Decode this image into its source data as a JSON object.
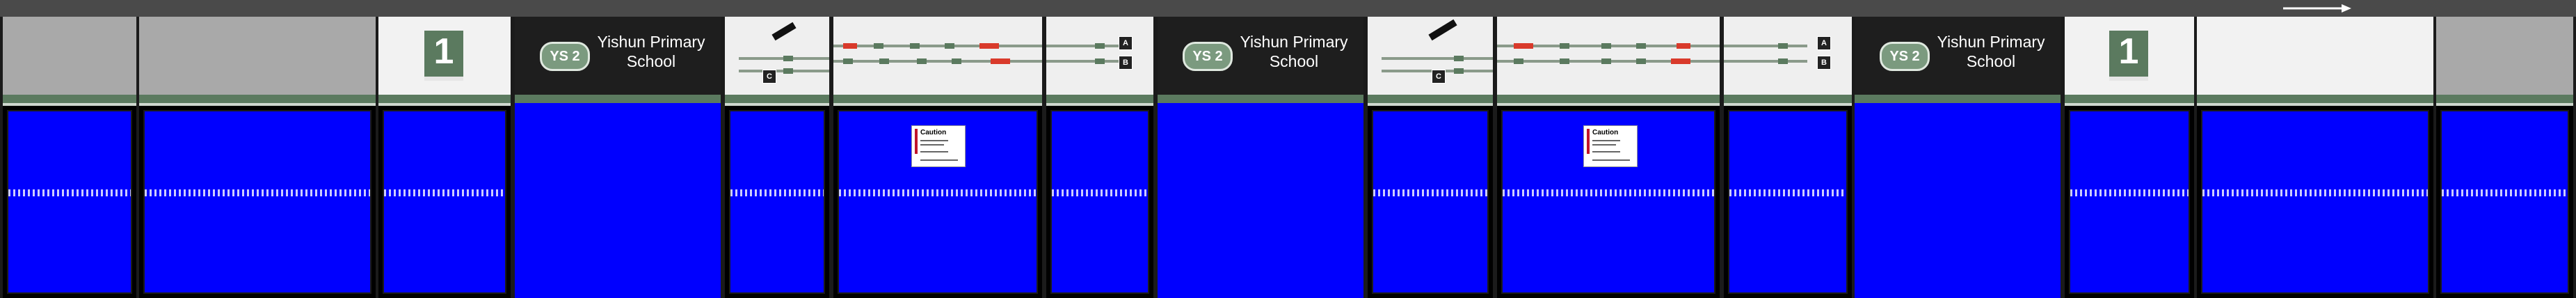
{
  "platform_number": "1",
  "station_code": "YS 2",
  "station_name_line1": "Yishun Primary",
  "station_name_line2": "School",
  "caution_title": "Caution",
  "map_dir_a": "A",
  "map_dir_b": "B",
  "map_dir_c": "C",
  "colors": {
    "screen_blue": "#0000ff",
    "header_green": "#5b7a5f",
    "badge_green": "#7b9a7f",
    "caution_red": "#c0152b",
    "map_red": "#d93a2b"
  },
  "icons": [
    "direction-arrow-icon"
  ]
}
